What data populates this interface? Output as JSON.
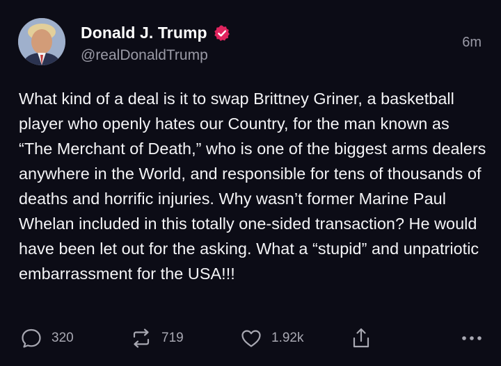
{
  "author": {
    "display_name": "Donald J. Trump",
    "handle": "@realDonaldTrump",
    "verified": true,
    "avatar": "profile-photo"
  },
  "timestamp": "6m",
  "body": "What kind of a deal is it to swap Brittney Griner, a basketball player who openly hates our Country, for the man known as “The Merchant of Death,” who is one of the biggest arms dealers anywhere in the World, and responsible for tens of thousands of deaths and horrific injuries. Why wasn’t former Marine Paul Whelan included in this totally one-sided transaction? He would have been let out for the asking. What a “stupid” and unpatriotic embarrassment for the USA!!!",
  "actions": {
    "reply": {
      "icon": "reply-icon",
      "count": "320"
    },
    "repost": {
      "icon": "repost-icon",
      "count": "719"
    },
    "like": {
      "icon": "heart-icon",
      "count": "1.92k"
    },
    "share": {
      "icon": "share-icon"
    },
    "more": {
      "icon": "more-icon"
    }
  },
  "colors": {
    "background": "#0c0c16",
    "text": "#f4f4f6",
    "muted": "#9a9aa6",
    "verified_badge": "#e0245e"
  }
}
